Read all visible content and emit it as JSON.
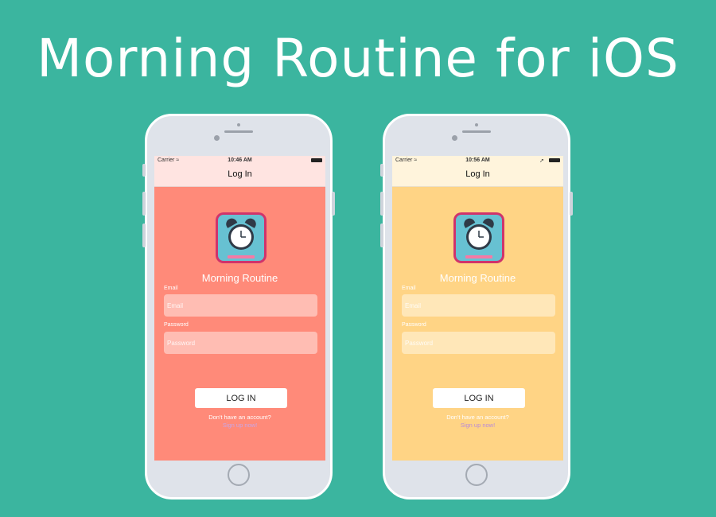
{
  "headline": "Morning Routine for iOS",
  "phones": [
    {
      "theme": {
        "bg": "#ff8a79",
        "nav": "#ffe4e1",
        "field": "#ffbdb3",
        "signup": "#c9a5e6"
      },
      "status": {
        "carrier": "Carrier ≈",
        "time": "10:46 AM"
      },
      "nav_title": "Log In",
      "app_name": "Morning Routine",
      "email_label": "Email",
      "email_placeholder": "Email",
      "password_label": "Password",
      "password_placeholder": "Password",
      "login_label": "LOG IN",
      "no_account": "Don't have an account?",
      "signup_label": "Sign up now!"
    },
    {
      "theme": {
        "bg": "#ffd485",
        "nav": "#fff4dc",
        "field": "#ffe7b8",
        "signup": "#b98ad8"
      },
      "status": {
        "carrier": "Carrier ≈",
        "time": "10:56 AM",
        "loc": "➚"
      },
      "nav_title": "Log In",
      "app_name": "Morning Routine",
      "email_label": "Email",
      "email_placeholder": "Email",
      "password_label": "Password",
      "password_placeholder": "Password",
      "login_label": "LOG IN",
      "no_account": "Don't have an account?",
      "signup_label": "Sign up now!"
    }
  ]
}
